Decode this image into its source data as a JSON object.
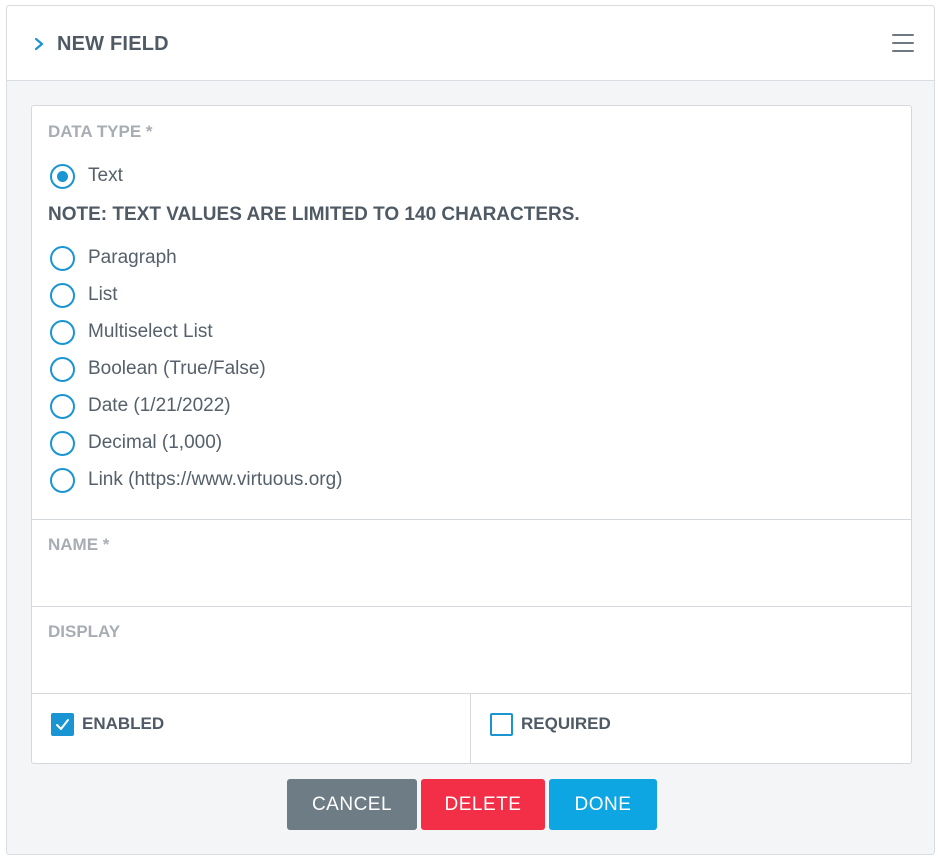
{
  "header": {
    "title": "NEW FIELD",
    "expand_icon": "chevron-right-icon",
    "menu_icon": "hamburger-menu-icon"
  },
  "data_type": {
    "label": "DATA TYPE *",
    "note": "NOTE: TEXT VALUES ARE LIMITED TO 140 CHARACTERS.",
    "selected": "Text",
    "options": [
      "Text",
      "Paragraph",
      "List",
      "Multiselect List",
      "Boolean (True/False)",
      "Date (1/21/2022)",
      "Decimal (1,000)",
      "Link (https://www.virtuous.org)"
    ]
  },
  "name_field": {
    "label": "NAME *",
    "value": ""
  },
  "display_field": {
    "label": "DISPLAY",
    "value": ""
  },
  "enabled": {
    "label": "ENABLED",
    "checked": true
  },
  "required": {
    "label": "REQUIRED",
    "checked": false
  },
  "buttons": {
    "cancel": "CANCEL",
    "delete": "DELETE",
    "done": "DONE"
  },
  "colors": {
    "accent": "#1a95d3",
    "cancel_bg": "#6e7c86",
    "delete_bg": "#f22f46",
    "done_bg": "#0ea5e3"
  }
}
